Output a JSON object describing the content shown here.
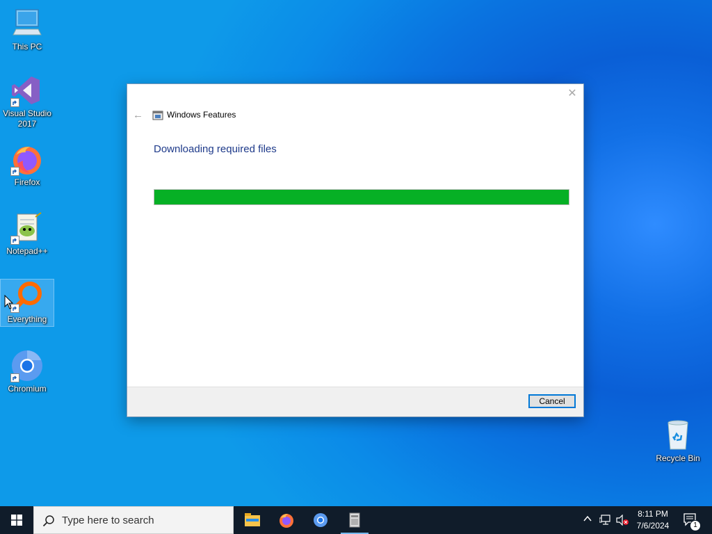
{
  "desktop": {
    "icons": [
      {
        "label_line1": "This PC",
        "label_line2": ""
      },
      {
        "label_line1": "Visual Studio",
        "label_line2": "2017"
      },
      {
        "label_line1": "Firefox",
        "label_line2": ""
      },
      {
        "label_line1": "Notepad++",
        "label_line2": ""
      },
      {
        "label_line1": "Everything",
        "label_line2": ""
      },
      {
        "label_line1": "Chromium",
        "label_line2": ""
      },
      {
        "label_line1": "Recycle Bin",
        "label_line2": ""
      }
    ]
  },
  "dialog": {
    "title": "Windows Features",
    "heading": "Downloading required files",
    "progress_percent": 100,
    "progress_color": "#06b025",
    "cancel_label": "Cancel",
    "close_glyph": "✕",
    "back_glyph": "←"
  },
  "taskbar": {
    "search_placeholder": "Type here to search",
    "apps": [
      "file-explorer",
      "firefox",
      "chromium",
      "windows-features"
    ],
    "clock_time": "8:11 PM",
    "clock_date": "7/6/2024",
    "notification_count": "1",
    "tray_chevron": "^"
  },
  "colors": {
    "accent": "#0078d7",
    "heading": "#1e3a8a",
    "taskbar": "#101c2a"
  }
}
